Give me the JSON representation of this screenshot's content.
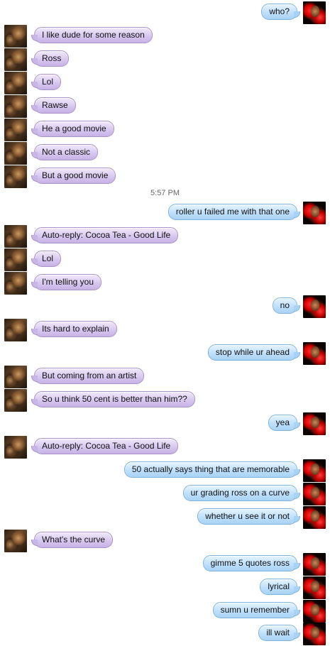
{
  "timestamp": "5:57 PM",
  "messages": [
    {
      "side": "right",
      "text": "who?"
    },
    {
      "side": "left",
      "text": "I like dude for some reason"
    },
    {
      "side": "left",
      "text": "Ross"
    },
    {
      "side": "left",
      "text": "Lol"
    },
    {
      "side": "left",
      "text": "Rawse"
    },
    {
      "side": "left",
      "text": "He a good movie"
    },
    {
      "side": "left",
      "text": "Not a classic"
    },
    {
      "side": "left",
      "text": "But a good movie"
    },
    {
      "side": "right",
      "text": "roller u failed me with that one"
    },
    {
      "side": "left",
      "text": "Auto-reply: Cocoa Tea - Good Life"
    },
    {
      "side": "left",
      "text": "Lol"
    },
    {
      "side": "left",
      "text": "I'm telling you"
    },
    {
      "side": "right",
      "text": "no"
    },
    {
      "side": "left",
      "text": "Its hard to explain"
    },
    {
      "side": "right",
      "text": "stop while ur ahead"
    },
    {
      "side": "left",
      "text": "But coming from an artist"
    },
    {
      "side": "left",
      "text": "So u think 50 cent is better than him??"
    },
    {
      "side": "right",
      "text": "yea"
    },
    {
      "side": "left",
      "text": "Auto-reply: Cocoa Tea - Good Life"
    },
    {
      "side": "right",
      "text": "50 actually says thing that are memorable"
    },
    {
      "side": "right",
      "text": "ur grading ross on a curve"
    },
    {
      "side": "right",
      "text": "whether u see it or not"
    },
    {
      "side": "left",
      "text": "What's the curve"
    },
    {
      "side": "right",
      "text": "gimme 5 quotes ross"
    },
    {
      "side": "right",
      "text": "lyrical"
    },
    {
      "side": "right",
      "text": "sumn u remember"
    },
    {
      "side": "right",
      "text": "ill wait"
    }
  ]
}
